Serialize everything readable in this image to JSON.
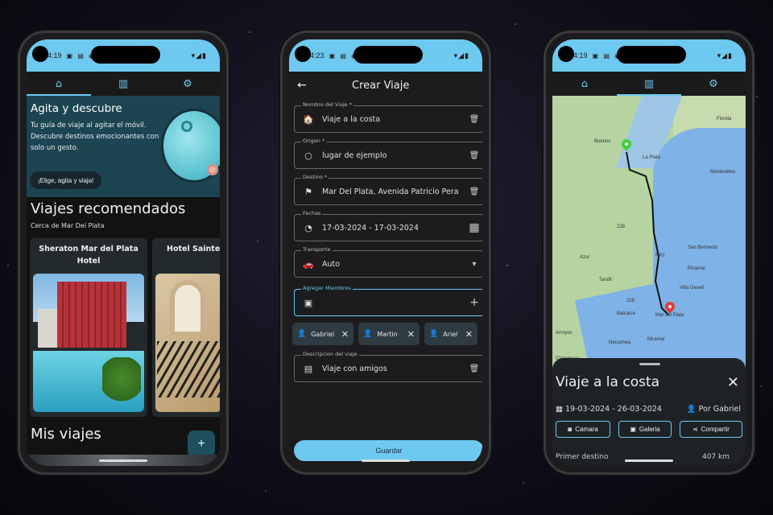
{
  "status": {
    "time_left": "4:19",
    "time_mid": "4:23",
    "time_right": "4:19",
    "icons": "▣ ▤ ◉ •",
    "right_icons": "▾◢▮"
  },
  "tabs": {
    "home_icon": "home-icon",
    "map_icon": "map-icon",
    "settings_icon": "gear-icon"
  },
  "home": {
    "hero_title": "Agita y descubre",
    "hero_desc": "Tu guía de viaje al agitar el móvil. Descubre destinos emocionantes con solo un gesto.",
    "hero_button": "¡Elige, agita y viaja!",
    "recommended_title": "Viajes recomendados",
    "recommended_sub": "Cerca de Mar Del Plata",
    "hotels": [
      {
        "name": "Sheraton Mar del Plata Hotel"
      },
      {
        "name": "Hotel Sainte J"
      }
    ],
    "my_trips_title": "Mis viajes",
    "fab_label": "+"
  },
  "create": {
    "back": "←",
    "title": "Crear Viaje",
    "fields": [
      {
        "label": "Nombre del Viaje *",
        "value": "Viaje a la costa",
        "icon": "🏠",
        "action": "🗑"
      },
      {
        "label": "Origen *",
        "value": "lugar de ejemplo",
        "icon": "○",
        "action": "🗑"
      },
      {
        "label": "Destino *",
        "value": "Mar Del Plata, Avenida Patricio Pera",
        "icon": "⚑",
        "action": "🗑"
      },
      {
        "label": "Fechas",
        "value": "17-03-2024 - 17-03-2024",
        "icon": "◔",
        "action": "▦"
      },
      {
        "label": "Transporte",
        "value": "Auto",
        "icon": "🚗",
        "action": "▾"
      },
      {
        "label": "Agregar Miembros",
        "value": "",
        "icon": "▣",
        "action": "+"
      },
      {
        "label": "Descripcion del viaje",
        "value": "Viaje con amigos",
        "icon": "▤",
        "action": "🗑"
      }
    ],
    "members": [
      "Gabriel",
      "Martin",
      "Ariel"
    ],
    "save_label": "Guardar"
  },
  "trip": {
    "map_labels": [
      "Florida",
      "Buenos",
      "La Plata",
      "Montevideo",
      "Azul",
      "Tandil",
      "San Bernardo",
      "Pinamar",
      "Villa Gesell",
      "Balcarce",
      "Mar del Plata",
      "Necochea",
      "Miramar",
      "Arroyos",
      "Claromeco",
      "RP2",
      "226",
      "228"
    ],
    "title": "Viaje a la costa",
    "close": "✕",
    "dates": "19-03-2024 - 26-03-2024",
    "by": "Por Gabriel",
    "buttons": {
      "camera": "Camara",
      "gallery": "Galeria",
      "share": "Compartir"
    },
    "distance_label": "Primer destino",
    "distance_value": "407 km"
  },
  "colors": {
    "accent": "#6ec9f0",
    "origin_pin": "#3dd13a",
    "dest_pin": "#e23b3b"
  }
}
